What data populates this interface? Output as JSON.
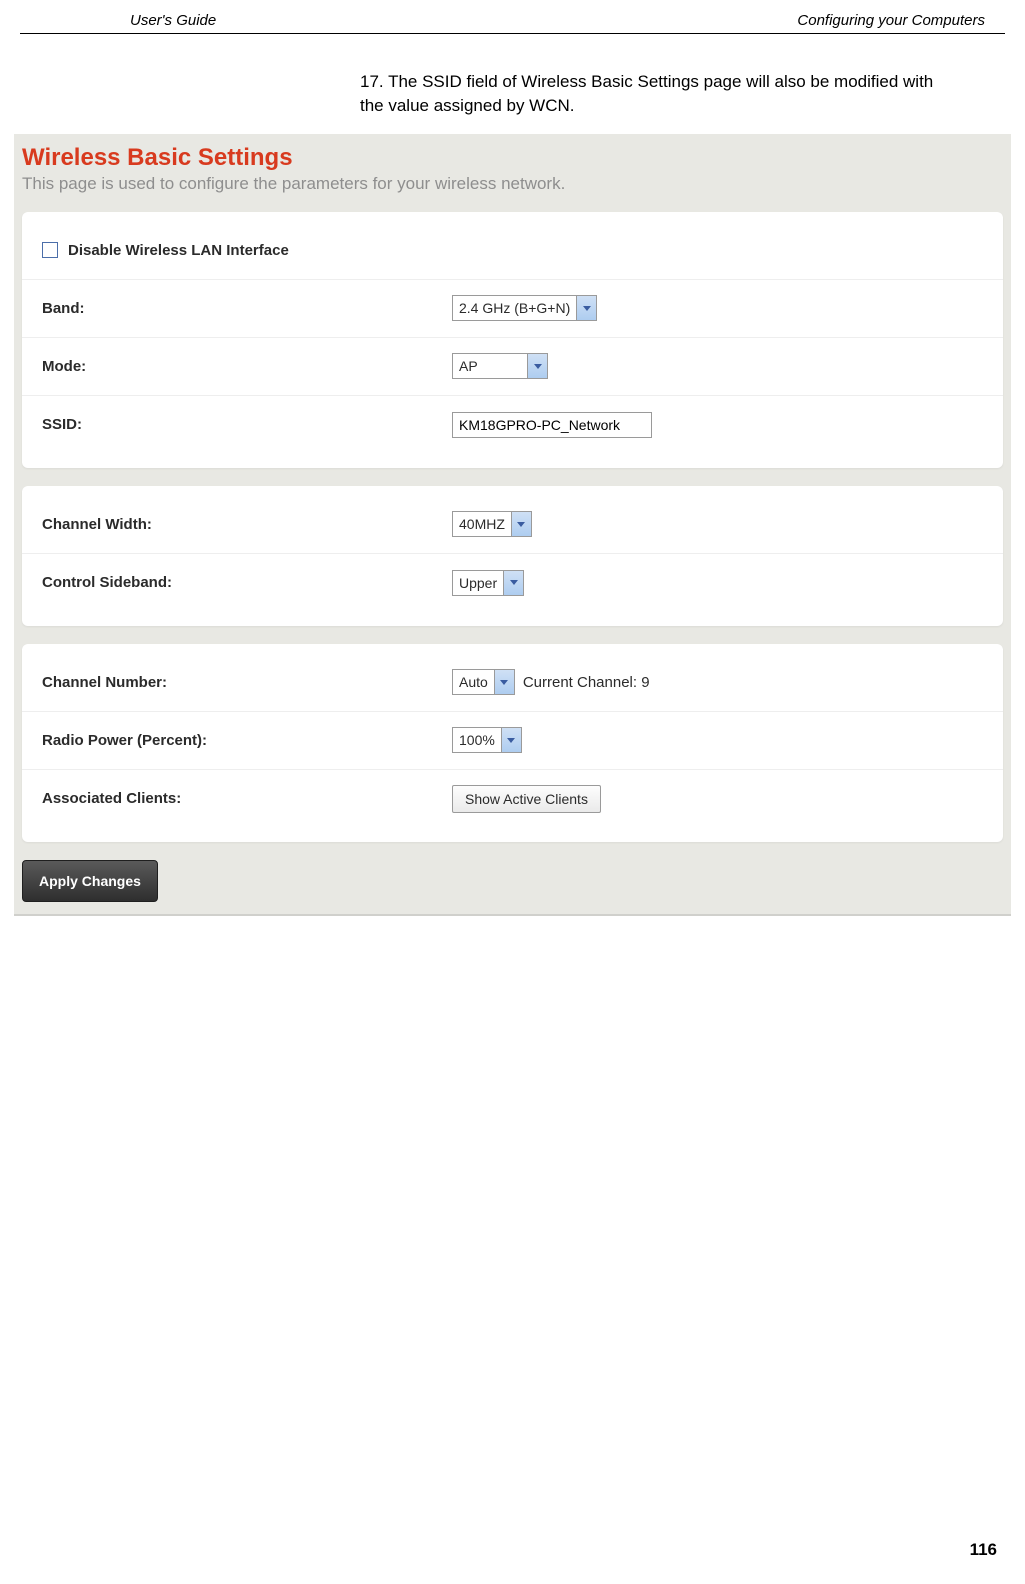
{
  "header": {
    "left": "User's Guide",
    "right": "Configuring your Computers"
  },
  "step": {
    "number": "17.",
    "text": "The SSID field of Wireless Basic Settings page will also be modified with the value assigned by WCN."
  },
  "wbs": {
    "title": "Wireless Basic Settings",
    "desc": "This page is used to configure the parameters for your wireless network."
  },
  "panel1": {
    "disable_label": "Disable Wireless LAN Interface",
    "band_label": "Band:",
    "band_value": "2.4 GHz (B+G+N)",
    "mode_label": "Mode:",
    "mode_value": "AP",
    "ssid_label": "SSID:",
    "ssid_value": "KM18GPRO-PC_Network"
  },
  "panel2": {
    "chwidth_label": "Channel Width:",
    "chwidth_value": "40MHZ",
    "sideband_label": "Control Sideband:",
    "sideband_value": "Upper"
  },
  "panel3": {
    "chnum_label": "Channel Number:",
    "chnum_value": "Auto",
    "chnum_extra": "Current Channel: 9",
    "radio_label": "Radio Power (Percent):",
    "radio_value": "100%",
    "clients_label": "Associated Clients:",
    "clients_button": "Show Active Clients"
  },
  "apply": {
    "label": "Apply Changes"
  },
  "page_number": "116"
}
